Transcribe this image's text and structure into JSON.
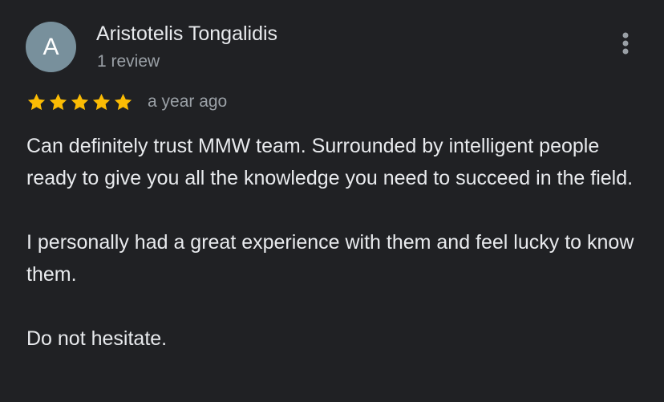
{
  "review": {
    "avatar_letter": "A",
    "avatar_color": "#78909c",
    "reviewer_name": "Aristotelis Tongalidis",
    "review_count": "1 review",
    "rating": 5,
    "rating_max": 5,
    "star_color": "#fbbc04",
    "date": "a year ago",
    "paragraphs": [
      "Can definitely trust MMW team. Surrounded by intelligent people ready to give you all the knowledge you need to succeed in the field.",
      "I personally had a great experience with them and feel lucky to know them.",
      "Do not hesitate."
    ],
    "menu_icon": "more-vertical-icon"
  },
  "theme": {
    "background": "#202124",
    "text_primary": "#e8eaed",
    "text_secondary": "#9aa0a6"
  }
}
